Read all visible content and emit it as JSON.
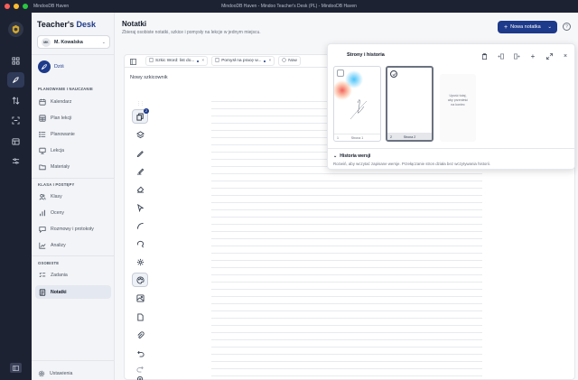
{
  "window": {
    "left_title": "MindooDB Haven",
    "title": "MindooDB Haven - Mindoo Teacher's Desk (PL) - MindooDB Haven",
    "traffic_lights": [
      "#ff5f57",
      "#febc2e",
      "#28c840"
    ]
  },
  "brand": {
    "part1": "Teacher's",
    "part2": " Desk"
  },
  "user": {
    "initials": "MK",
    "name": "M. Kowalska"
  },
  "sidebar": {
    "today": "Dziś",
    "sections": [
      {
        "label": "PLANOWANIE I NAUCZANIE",
        "items": [
          "Kalendarz",
          "Plan lekcji",
          "Planowanie",
          "Lekcja",
          "Materiały"
        ]
      },
      {
        "label": "KLASA I POSTĘPY",
        "items": [
          "Klasy",
          "Oceny",
          "Rozmowy i protokoły",
          "Analizy"
        ]
      },
      {
        "label": "OSOBISTE",
        "items": [
          "Zadania",
          "Notatki"
        ]
      }
    ],
    "settings": "Ustawienia"
  },
  "header": {
    "title": "Notatki",
    "subtitle": "Zbieraj osobiste notatki, szkice i pomysły na lekcje w jednym miejscu.",
    "new_button": "Nowa notatka"
  },
  "tabs": [
    {
      "label": "Szkic Word: list do...",
      "modified": true
    },
    {
      "label": "Pomysł na pracę w...",
      "modified": true
    },
    {
      "label": "Now",
      "modified": false
    }
  ],
  "document": {
    "title": "Nowy szkicownik"
  },
  "toolbar": {
    "badge": "2"
  },
  "pages_panel": {
    "title": "Strony i historia",
    "pages": [
      {
        "label": "Strona 1",
        "number": "1"
      },
      {
        "label": "Strona 2",
        "number": "2"
      }
    ],
    "drop_hint": [
      "Upuść tutaj,",
      "aby przenieść",
      "na koniec"
    ],
    "history_title": "Historia wersji",
    "history_text": "Rozwiń, aby wczytać zapisane wersje. Przełączanie stron działa bez wczytywania historii."
  },
  "colors": {
    "accent": "#1e3a8a",
    "rail": "#1d2233"
  }
}
